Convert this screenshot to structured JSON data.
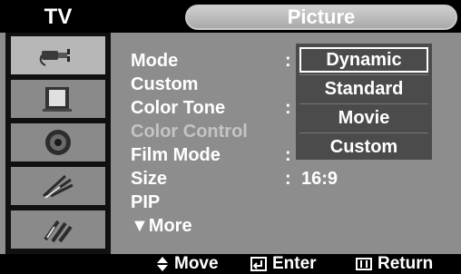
{
  "header": {
    "section": "TV",
    "title": "Picture"
  },
  "sidebar": {
    "icons": [
      {
        "name": "input-plug-icon",
        "active": true
      },
      {
        "name": "picture-screen-icon",
        "active": false
      },
      {
        "name": "speaker-sound-icon",
        "active": false
      },
      {
        "name": "antenna-channel-icon",
        "active": false
      },
      {
        "name": "tools-setup-icon",
        "active": false
      }
    ]
  },
  "menu": {
    "items": [
      {
        "label": "Mode",
        "has_colon": true
      },
      {
        "label": "Custom",
        "has_colon": false
      },
      {
        "label": "Color Tone",
        "has_colon": true
      },
      {
        "label": "Color Control",
        "has_colon": false,
        "disabled": true
      },
      {
        "label": "Film Mode",
        "has_colon": true
      },
      {
        "label": "Size",
        "has_colon": true,
        "value": "16:9"
      },
      {
        "label": "PIP",
        "has_colon": false
      },
      {
        "label": "▼More",
        "has_colon": false
      }
    ]
  },
  "dropdown": {
    "options": [
      "Dynamic",
      "Standard",
      "Movie",
      "Custom"
    ],
    "selected": "Dynamic"
  },
  "footer": {
    "move": "Move",
    "enter": "Enter",
    "return": "Return"
  },
  "colors": {
    "panel": "#8d8d8d",
    "icon_bar": "#101010",
    "dropdown": "#4b4b4b",
    "text": "#ffffff"
  }
}
